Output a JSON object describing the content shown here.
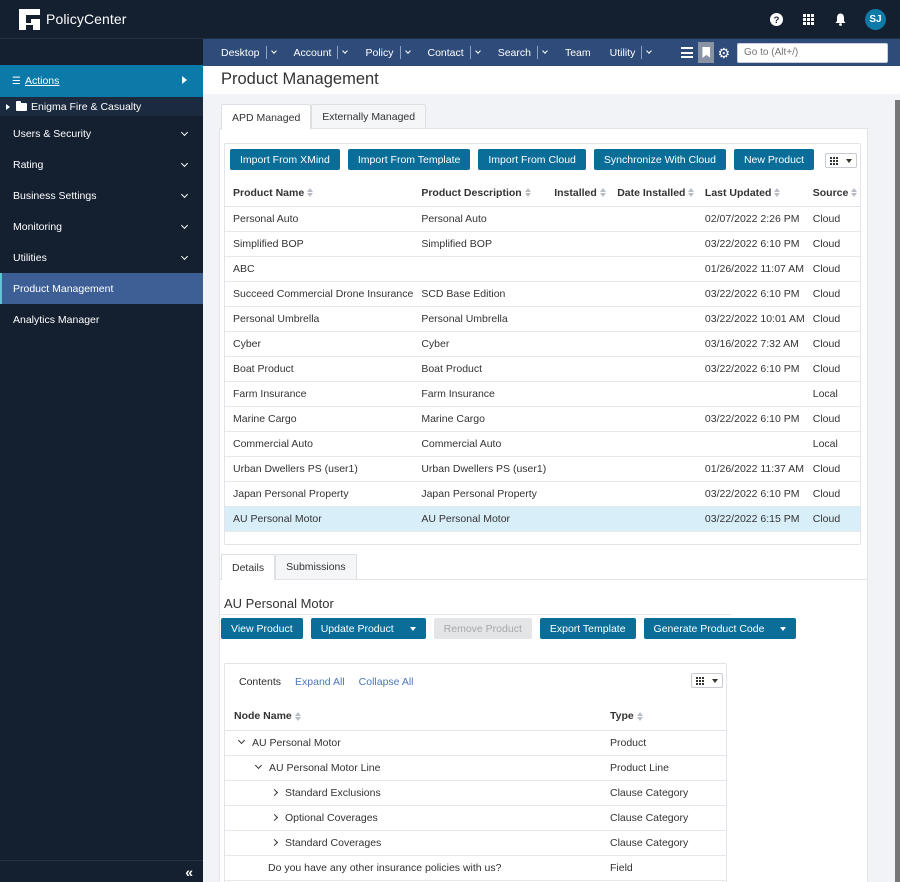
{
  "app": {
    "title": "PolicyCenter",
    "user_initials": "SJ",
    "icons": [
      "help-icon",
      "apps-grid-icon",
      "notifications-bell-icon"
    ]
  },
  "navbar": {
    "items": [
      {
        "label": "Desktop",
        "has_dropdown": true
      },
      {
        "label": "Account",
        "has_dropdown": true
      },
      {
        "label": "Policy",
        "has_dropdown": true
      },
      {
        "label": "Contact",
        "has_dropdown": true
      },
      {
        "label": "Search",
        "has_dropdown": true
      },
      {
        "label": "Team",
        "has_dropdown": false
      },
      {
        "label": "Utility",
        "has_dropdown": true
      }
    ],
    "goto_placeholder": "Go to (Alt+/)"
  },
  "sidebar": {
    "actions_label": "Actions",
    "org_label": "Enigma Fire & Casualty",
    "items": [
      {
        "label": "Users & Security",
        "expandable": true,
        "active": false
      },
      {
        "label": "Rating",
        "expandable": true,
        "active": false
      },
      {
        "label": "Business Settings",
        "expandable": true,
        "active": false
      },
      {
        "label": "Monitoring",
        "expandable": true,
        "active": false
      },
      {
        "label": "Utilities",
        "expandable": true,
        "active": false
      },
      {
        "label": "Product Management",
        "expandable": false,
        "active": true
      },
      {
        "label": "Analytics Manager",
        "expandable": false,
        "active": false
      }
    ]
  },
  "main": {
    "page_title": "Product Management",
    "tabs": [
      {
        "label": "APD Managed",
        "active": true
      },
      {
        "label": "Externally Managed",
        "active": false
      }
    ],
    "toolbar": {
      "import_xmind": "Import From XMind",
      "import_template": "Import From Template",
      "import_cloud": "Import From Cloud",
      "sync_cloud": "Synchronize With Cloud",
      "new_product": "New Product"
    },
    "products_table": {
      "columns": [
        "Product Name",
        "Product Description",
        "Installed",
        "Date Installed",
        "Last Updated",
        "Source"
      ],
      "rows": [
        {
          "name": "Personal Auto",
          "description": "Personal Auto",
          "installed": "",
          "date_installed": "",
          "last_updated": "02/07/2022 2:26 PM",
          "source": "Cloud"
        },
        {
          "name": "Simplified BOP",
          "description": "Simplified BOP",
          "installed": "",
          "date_installed": "",
          "last_updated": "03/22/2022 6:10 PM",
          "source": "Cloud"
        },
        {
          "name": "ABC",
          "description": "",
          "installed": "",
          "date_installed": "",
          "last_updated": "01/26/2022 11:07 AM",
          "source": "Cloud"
        },
        {
          "name": "Succeed Commercial Drone Insurance",
          "description": "SCD Base Edition",
          "installed": "",
          "date_installed": "",
          "last_updated": "03/22/2022 6:10 PM",
          "source": "Cloud"
        },
        {
          "name": "Personal Umbrella",
          "description": "Personal Umbrella",
          "installed": "",
          "date_installed": "",
          "last_updated": "03/22/2022 10:01 AM",
          "source": "Cloud"
        },
        {
          "name": "Cyber",
          "description": "Cyber",
          "installed": "",
          "date_installed": "",
          "last_updated": "03/16/2022 7:32 AM",
          "source": "Cloud"
        },
        {
          "name": "Boat Product",
          "description": "Boat Product",
          "installed": "",
          "date_installed": "",
          "last_updated": "03/22/2022 6:10 PM",
          "source": "Cloud"
        },
        {
          "name": "Farm Insurance",
          "description": "Farm Insurance",
          "installed": "",
          "date_installed": "",
          "last_updated": "",
          "source": "Local"
        },
        {
          "name": "Marine Cargo",
          "description": "Marine Cargo",
          "installed": "",
          "date_installed": "",
          "last_updated": "03/22/2022 6:10 PM",
          "source": "Cloud"
        },
        {
          "name": "Commercial Auto",
          "description": "Commercial Auto",
          "installed": "",
          "date_installed": "",
          "last_updated": "",
          "source": "Local"
        },
        {
          "name": "Urban Dwellers PS (user1)",
          "description": "Urban Dwellers PS (user1)",
          "installed": "",
          "date_installed": "",
          "last_updated": "01/26/2022 11:37 AM",
          "source": "Cloud"
        },
        {
          "name": "Japan Personal Property",
          "description": "Japan Personal Property",
          "installed": "",
          "date_installed": "",
          "last_updated": "03/22/2022 6:10 PM",
          "source": "Cloud"
        },
        {
          "name": "AU Personal Motor",
          "description": "AU Personal Motor",
          "installed": "",
          "date_installed": "",
          "last_updated": "03/22/2022 6:15 PM",
          "source": "Cloud",
          "selected": true
        }
      ]
    },
    "detail_tabs": [
      {
        "label": "Details",
        "active": true
      },
      {
        "label": "Submissions",
        "active": false
      }
    ],
    "detail": {
      "title": "AU Personal Motor",
      "buttons": {
        "view_product": "View Product",
        "update_product": "Update Product",
        "remove_product": "Remove Product",
        "export_template": "Export Template",
        "generate_code": "Generate Product Code"
      },
      "contents_label": "Contents",
      "expand_all": "Expand All",
      "collapse_all": "Collapse All",
      "node_table": {
        "columns": [
          "Node Name",
          "Type"
        ],
        "rows": [
          {
            "name": "AU Personal Motor",
            "type": "Product",
            "level": 0,
            "toggle": "expanded"
          },
          {
            "name": "AU Personal Motor Line",
            "type": "Product Line",
            "level": 1,
            "toggle": "expanded"
          },
          {
            "name": "Standard Exclusions",
            "type": "Clause Category",
            "level": 2,
            "toggle": "collapsed"
          },
          {
            "name": "Optional Coverages",
            "type": "Clause Category",
            "level": 2,
            "toggle": "collapsed"
          },
          {
            "name": "Standard Coverages",
            "type": "Clause Category",
            "level": 2,
            "toggle": "collapsed"
          },
          {
            "name": "Do you have any other insurance policies with us?",
            "type": "Field",
            "level": 2,
            "toggle": "none"
          }
        ]
      }
    }
  },
  "colors": {
    "header_bg": "#141f30",
    "nav_bg": "#2e4b7a",
    "accent_blue": "#0b7aa8",
    "button_bg": "#0b6e99",
    "sidebar_active": "#3d5f96",
    "selected_row": "#d8eef8",
    "link": "#4b78b8"
  }
}
